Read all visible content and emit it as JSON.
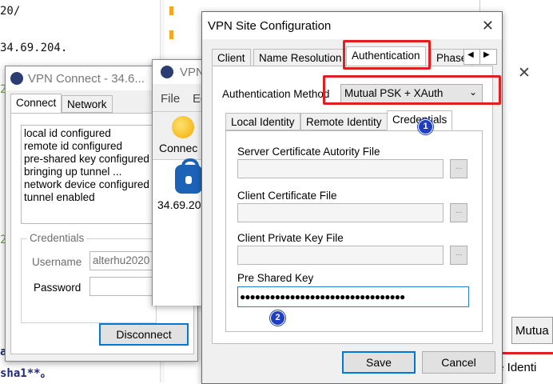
{
  "background": {
    "line1": "20/",
    "line2": "34.69.204.",
    "line3": "sha1**。",
    "frag_a": "a",
    "frag_mutua": "Mutua",
    "frag_identi": "te Identi",
    "frag_2a": "2",
    "frag_2b": "2"
  },
  "connect_window": {
    "title": "VPN Connect - 34.6...",
    "tabs": [
      "Connect",
      "Network"
    ],
    "log": [
      "local id configured",
      "remote id configured",
      "pre-shared key configured",
      "bringing up tunnel ...",
      "network device configured",
      "tunnel enabled"
    ],
    "credentials_label": "Credentials",
    "username_label": "Username",
    "username_value": "alterhu2020",
    "password_label": "Password",
    "disconnect_label": "Disconnect"
  },
  "client_window": {
    "title": "VPN",
    "menu": [
      "File",
      "Ed"
    ],
    "connect_label": "Connec",
    "site_label": "34.69.20"
  },
  "config_dialog": {
    "title": "VPN Site Configuration",
    "tabs": [
      "Client",
      "Name Resolution",
      "Authentication",
      "Phase"
    ],
    "auth_method_label": "Authentication Method",
    "auth_method_value": "Mutual PSK + XAuth",
    "inner_tabs": [
      "Local Identity",
      "Remote Identity",
      "Credentials"
    ],
    "server_cert_label": "Server Certificate Autority File",
    "client_cert_label": "Client Certificate File",
    "client_key_label": "Client Private Key File",
    "psk_label": "Pre Shared Key",
    "psk_value": "●●●●●●●●●●●●●●●●●●●●●●●●●●●●●●●●●",
    "browse_label": "...",
    "save_label": "Save",
    "cancel_label": "Cancel",
    "badge1": "1",
    "badge2": "2"
  }
}
